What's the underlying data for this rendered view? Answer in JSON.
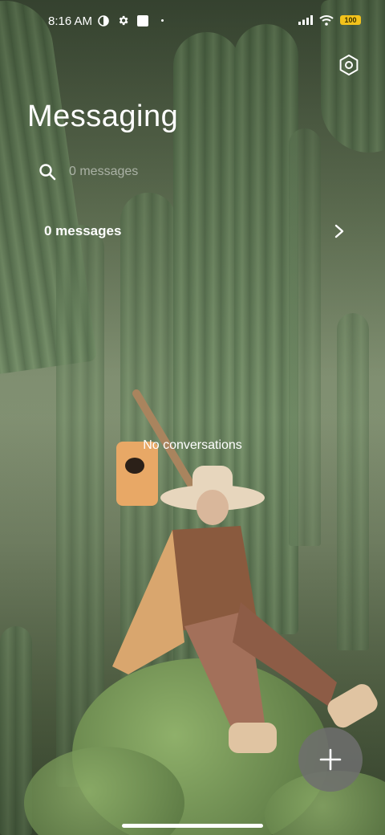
{
  "status_bar": {
    "time": "8:16 AM",
    "battery": "100",
    "icons_left": [
      "theme-icon",
      "gear-icon",
      "square-icon",
      "dot-icon"
    ],
    "icons_right": [
      "signal-icon",
      "wifi-icon",
      "battery-icon"
    ]
  },
  "header": {
    "title": "Messaging",
    "settings_icon": "settings-icon"
  },
  "search": {
    "placeholder": "0 messages",
    "icon": "search-icon"
  },
  "summary": {
    "label": "0 messages",
    "icon": "chevron-right-icon"
  },
  "main": {
    "empty_text": "No conversations"
  },
  "fab": {
    "icon": "plus-icon"
  },
  "colors": {
    "battery": "#f3c21b",
    "fab": "#6e6e6e"
  }
}
